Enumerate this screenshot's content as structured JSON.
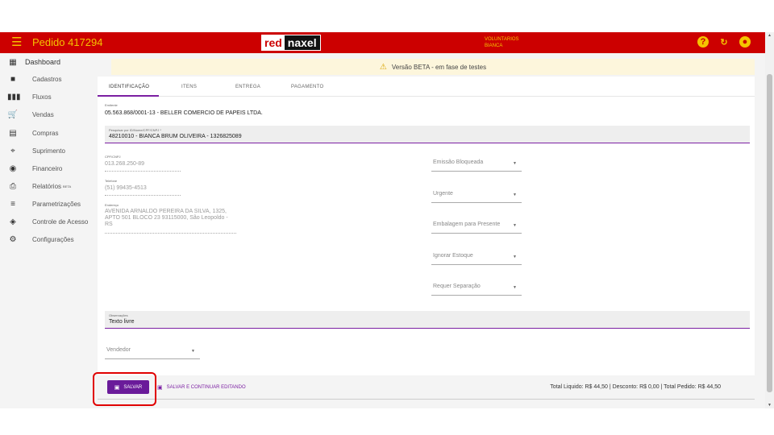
{
  "header": {
    "title": "Pedido 417294",
    "logo_red": "red",
    "logo_naxel": "naxel",
    "user_line1": "VOLUNTARIOS",
    "user_line2": "BIANCA",
    "icons": [
      "help-icon",
      "refresh-icon",
      "account-icon"
    ],
    "accent": "#cc0000",
    "title_color": "#f5c400"
  },
  "sidebar": {
    "items": [
      {
        "label": "Dashboard",
        "icon": "dashboard-icon"
      },
      {
        "label": "Cadastros",
        "icon": "folder-icon"
      },
      {
        "label": "Fluxos",
        "icon": "columns-icon"
      },
      {
        "label": "Vendas",
        "icon": "cart-icon"
      },
      {
        "label": "Compras",
        "icon": "building-icon"
      },
      {
        "label": "Suprimento",
        "icon": "crop-icon"
      },
      {
        "label": "Financeiro",
        "icon": "dollar-icon"
      },
      {
        "label": "Relatórios",
        "badge": "BETA",
        "icon": "print-icon"
      },
      {
        "label": "Parametrizações",
        "icon": "sliders-icon"
      },
      {
        "label": "Controle de Acesso",
        "icon": "shield-icon"
      },
      {
        "label": "Configurações",
        "icon": "gear-icon"
      }
    ]
  },
  "banner": {
    "text": "Versão BETA - em fase de testes"
  },
  "tabs": [
    "IDENTIFICAÇÃO",
    "ITENS",
    "ENTREGA",
    "PAGAMENTO"
  ],
  "form": {
    "emitente_label": "Emitente",
    "emitente_value": "05.563.868/0001-13 - BELLER COMERCIO DE PAPEIS LTDA.",
    "cliente_label": "Pesquisar por ID/Nome/CPF/CNPJ *",
    "cliente_value": "48210010 - BIANCA BRUM OLIVEIRA -  1326825089",
    "cpf_label": "CPF/CNPJ",
    "cpf_value": "013.268.250-89",
    "telefone_label": "Telefone",
    "telefone_value": "(51) 99435-4513",
    "endereco_label": "Endereço",
    "endereco_line1": "AVENIDA ARNALDO PEREIRA DA SILVA, 1325,",
    "endereco_line2": "APTO 501 BLOCO 23 93115000, São Leopoldo -",
    "endereco_line3": "RS",
    "selects": [
      "Emissão Bloqueada",
      "Urgente",
      "Embalagem para Presente",
      "Ignorar Estoque",
      "Requer Separação"
    ],
    "obs_label": "Observações",
    "obs_value": "Texto livre",
    "vendedor": "Vendedor"
  },
  "footer": {
    "save_label": "SALVAR",
    "save_continue_label": "SALVAR E CONTINUAR EDITANDO",
    "totals": "Total Liquido: R$ 44,50 | Desconto: R$ 0,00 | Total Pedido: R$ 44,50"
  }
}
